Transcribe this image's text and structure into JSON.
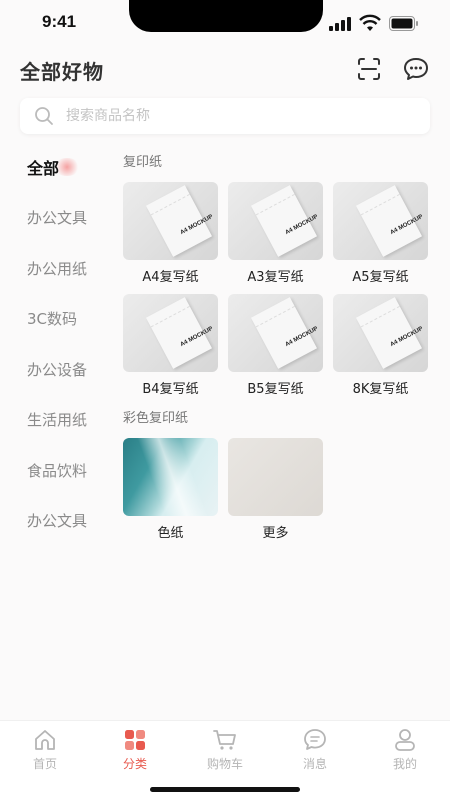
{
  "status_bar": {
    "time": "9:41"
  },
  "header": {
    "title": "全部好物",
    "scan_icon": "scan-icon",
    "message_icon": "message-icon"
  },
  "search": {
    "placeholder": "搜索商品名称",
    "icon": "search-icon"
  },
  "categories": [
    {
      "label": "全部",
      "active": true
    },
    {
      "label": "办公文具",
      "active": false
    },
    {
      "label": "办公用纸",
      "active": false
    },
    {
      "label": "3C数码",
      "active": false
    },
    {
      "label": "办公设备",
      "active": false
    },
    {
      "label": "生活用纸",
      "active": false
    },
    {
      "label": "食品饮料",
      "active": false
    },
    {
      "label": "办公文具",
      "active": false
    }
  ],
  "sections": [
    {
      "title": "复印纸",
      "items": [
        {
          "label": "A4复写纸",
          "mock_text": "A4 MOCKUP"
        },
        {
          "label": "A3复写纸",
          "mock_text": "A4 MOCKUP"
        },
        {
          "label": "A5复写纸",
          "mock_text": "A4 MOCKUP"
        },
        {
          "label": "B4复写纸",
          "mock_text": "A4 MOCKUP"
        },
        {
          "label": "B5复写纸",
          "mock_text": "A4 MOCKUP"
        },
        {
          "label": "8K复写纸",
          "mock_text": "A4 MOCKUP"
        }
      ]
    },
    {
      "title": "彩色复印纸",
      "items": [
        {
          "label": "色纸"
        },
        {
          "label": "更多"
        }
      ]
    }
  ],
  "tabbar": [
    {
      "label": "首页",
      "icon": "home-icon",
      "active": false
    },
    {
      "label": "分类",
      "icon": "category-icon",
      "active": true
    },
    {
      "label": "购物车",
      "icon": "cart-icon",
      "active": false
    },
    {
      "label": "消息",
      "icon": "chat-icon",
      "active": false
    },
    {
      "label": "我的",
      "icon": "profile-icon",
      "active": false
    }
  ],
  "colors": {
    "accent": "#e85a4f",
    "inactive": "#b5b5b5"
  }
}
